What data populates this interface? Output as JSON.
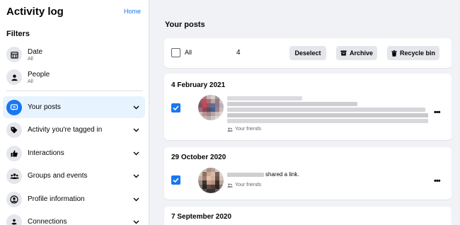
{
  "sidebar": {
    "title": "Activity log",
    "home_link": "Home",
    "filters_heading": "Filters",
    "filters": [
      {
        "label": "Date",
        "sub": "All",
        "icon": "calendar-icon"
      },
      {
        "label": "People",
        "sub": "All",
        "icon": "person-icon"
      }
    ],
    "nav": [
      {
        "label": "Your posts",
        "icon": "posts-icon",
        "active": true
      },
      {
        "label": "Activity you're tagged in",
        "icon": "tag-icon"
      },
      {
        "label": "Interactions",
        "icon": "thumbs-up-icon"
      },
      {
        "label": "Groups and events",
        "icon": "groups-icon"
      },
      {
        "label": "Profile information",
        "icon": "profile-icon"
      },
      {
        "label": "Connections",
        "icon": "connections-icon"
      }
    ]
  },
  "main": {
    "title": "Your posts",
    "toolbar": {
      "all_label": "All",
      "selected_count": "4",
      "deselect": "Deselect",
      "archive": "Archive",
      "recycle_bin": "Recycle bin"
    },
    "groups": [
      {
        "date": "4 February 2021",
        "audience": "Your friends",
        "checked": true
      },
      {
        "date": "29 October 2020",
        "action_text": "shared a link.",
        "audience": "Your friends",
        "checked": true
      },
      {
        "date": "7 September 2020"
      }
    ]
  },
  "colors": {
    "accent": "#1877f2",
    "background": "#f0f2f5",
    "active_nav": "#e7f3ff"
  }
}
